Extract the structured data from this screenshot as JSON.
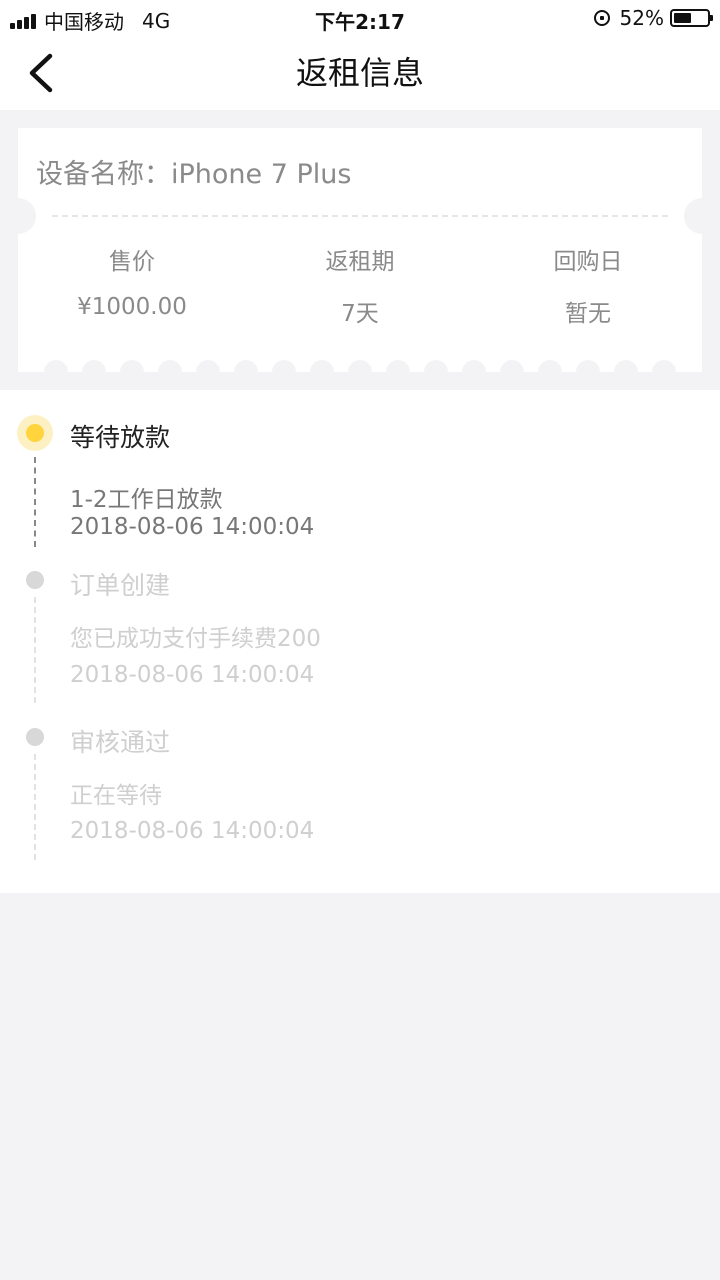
{
  "status_bar": {
    "carrier": "中国移动",
    "network": "4G",
    "time": "下午2:17",
    "battery_percent": "52%",
    "battery_level": 0.52
  },
  "nav": {
    "title": "返租信息",
    "back_icon": "chevron-left-icon"
  },
  "device": {
    "label": "设备名称：",
    "name": "iPhone 7 Plus"
  },
  "info": [
    {
      "label": "售价",
      "value": "¥1000.00"
    },
    {
      "label": "返租期",
      "value": "7天"
    },
    {
      "label": "回购日",
      "value": "暂无"
    }
  ],
  "timeline": [
    {
      "title": "等待放款",
      "detail": "1-2工作日放款",
      "time": "2018-08-06 14:00:04",
      "state": "active"
    },
    {
      "title": "订单创建",
      "detail": "您已成功支付手续费200",
      "time": "2018-08-06 14:00:04",
      "state": "inactive"
    },
    {
      "title": "审核通过",
      "detail": "正在等待",
      "time": "2018-08-06 14:00:04",
      "state": "inactive"
    }
  ],
  "colors": {
    "accent": "#ffd43d",
    "accent_halo": "#fdf1c4",
    "page_bg": "#f3f3f5",
    "muted_text": "#8a8a8a",
    "disabled_text": "#cfcfcf"
  }
}
